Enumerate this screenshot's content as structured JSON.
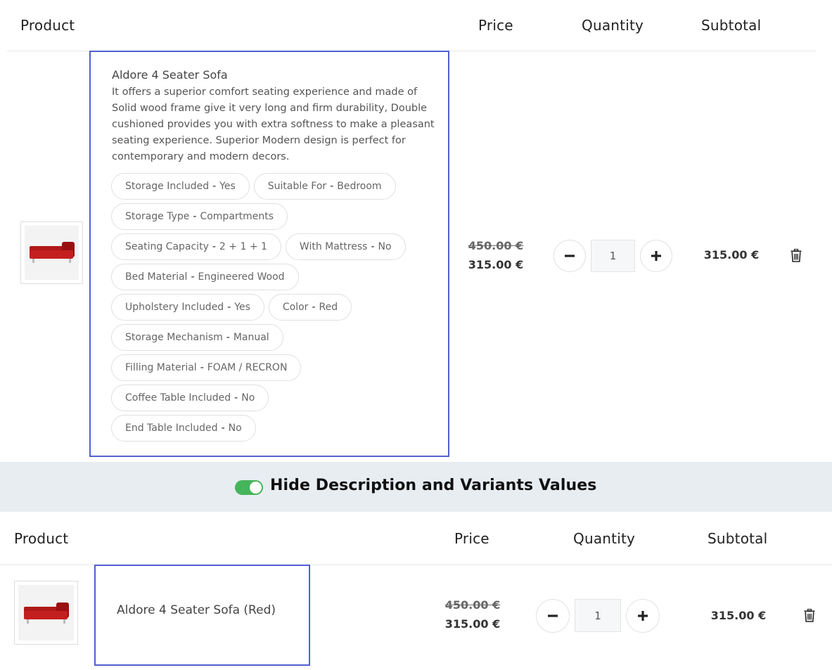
{
  "table1": {
    "headers": {
      "product": "Product",
      "price": "Price",
      "quantity": "Quantity",
      "subtotal": "Subtotal"
    },
    "item": {
      "name": "Aldore 4 Seater Sofa",
      "description": "It offers a superior comfort seating experience and made of Solid wood frame give it very long and firm durability, Double cushioned provides you with extra softness to make a pleasant seating experience. Superior Modern design is perfect for contemporary and modern decors.",
      "variants": [
        [
          {
            "name": "Storage Included",
            "value": "Yes"
          },
          {
            "name": "Suitable For",
            "value": "Bedroom"
          }
        ],
        [
          {
            "name": "Storage Type",
            "value": "Compartments"
          }
        ],
        [
          {
            "name": "Seating Capacity",
            "value": "2 + 1 + 1"
          },
          {
            "name": "With Mattress",
            "value": "No"
          }
        ],
        [
          {
            "name": "Bed Material",
            "value": "Engineered Wood"
          }
        ],
        [
          {
            "name": "Upholstery Included",
            "value": "Yes"
          },
          {
            "name": "Color",
            "value": "Red"
          }
        ],
        [
          {
            "name": "Storage Mechanism",
            "value": "Manual"
          }
        ],
        [
          {
            "name": "Filling Material",
            "value": "FOAM / RECRON"
          }
        ],
        [
          {
            "name": "Coffee Table Included",
            "value": "No"
          }
        ],
        [
          {
            "name": "End Table Included",
            "value": "No"
          }
        ]
      ],
      "old_price": "450.00 €",
      "price": "315.00 €",
      "quantity": "1",
      "subtotal": "315.00 €"
    }
  },
  "toggle": {
    "label": "Hide Description and Variants Values",
    "on": true,
    "color": "#46b45a"
  },
  "table2": {
    "headers": {
      "product": "Product",
      "price": "Price",
      "quantity": "Quantity",
      "subtotal": "Subtotal"
    },
    "item": {
      "name": "Aldore 4 Seater Sofa (Red)",
      "old_price": "450.00 €",
      "price": "315.00 €",
      "quantity": "1",
      "subtotal": "315.00 €"
    }
  },
  "colors": {
    "highlight": "#5060d0",
    "band": "#e8edf2",
    "product": "#c41f1f"
  }
}
